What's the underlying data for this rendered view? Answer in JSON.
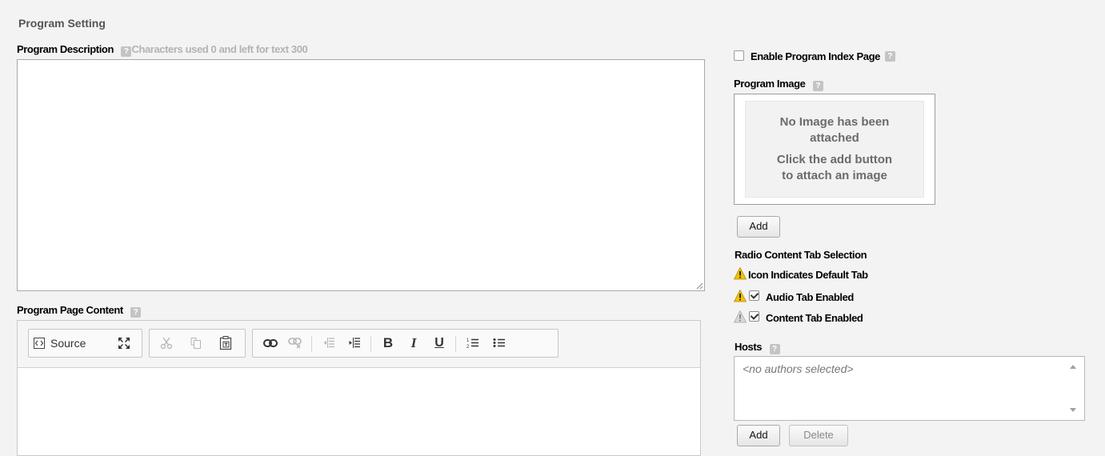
{
  "section_title": "Program Setting",
  "description": {
    "label": "Program Description",
    "hint": "Characters used 0 and left for text 300",
    "value": ""
  },
  "page_content": {
    "label": "Program Page Content",
    "toolbar": {
      "source_label": "Source",
      "bold": "B",
      "italic": "I",
      "underline": "U"
    }
  },
  "index_page": {
    "label": "Enable Program Index Page",
    "checked": false
  },
  "program_image": {
    "label": "Program Image",
    "empty_line1": "No Image has been",
    "empty_line2": "attached",
    "empty_line3": "Click the add button",
    "empty_line4": "to attach an image",
    "add_label": "Add"
  },
  "radio_tabs": {
    "title": "Radio Content Tab Selection",
    "legend": "Icon Indicates Default Tab",
    "audio_label": "Audio Tab Enabled",
    "content_label": "Content Tab Enabled",
    "audio_checked": true,
    "content_checked": true
  },
  "hosts": {
    "label": "Hosts",
    "placeholder": "<no authors selected>",
    "add_label": "Add",
    "delete_label": "Delete"
  },
  "colors": {
    "warning": "#f2c200",
    "warning_inactive": "#c9c9c9"
  }
}
